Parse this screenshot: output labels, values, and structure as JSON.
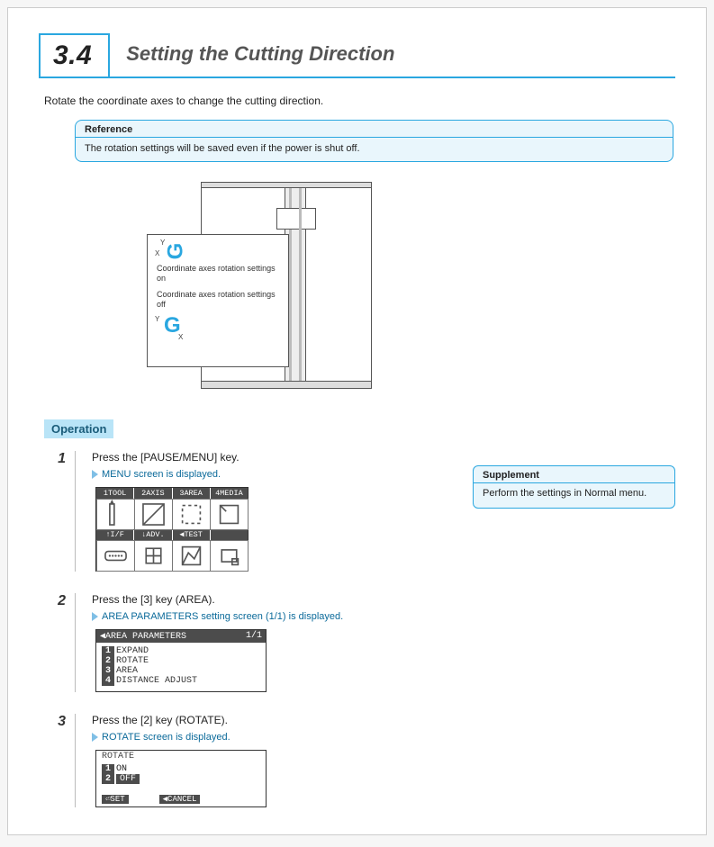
{
  "section": {
    "number": "3.4",
    "title": "Setting the Cutting Direction"
  },
  "intro": "Rotate the coordinate axes to change the cutting direction.",
  "reference": {
    "label": "Reference",
    "body": "The rotation settings will be saved even if the power is shut off."
  },
  "diagram": {
    "caption_on": "Coordinate axes rotation settings on",
    "caption_off": "Coordinate axes rotation settings off",
    "axis_y": "Y",
    "axis_x": "X"
  },
  "operation_label": "Operation",
  "supplement": {
    "label": "Supplement",
    "body": "Perform the settings in Normal menu."
  },
  "steps": [
    {
      "n": "1",
      "title": "Press the [PAUSE/MENU] key.",
      "sub": "MENU screen is displayed.",
      "menu_tabs_row1": [
        "1TOOL",
        "2AXIS",
        "3AREA",
        "4MEDIA"
      ],
      "menu_tabs_row2": [
        "↑I/F",
        "↓ADV.",
        "◀TEST",
        ""
      ]
    },
    {
      "n": "2",
      "title": "Press the [3] key (AREA).",
      "sub": "AREA PARAMETERS setting screen (1/1) is displayed.",
      "lcd_header_left": "◀AREA PARAMETERS",
      "lcd_header_right": "1/1",
      "items": [
        "EXPAND",
        "ROTATE",
        "AREA",
        "DISTANCE ADJUST"
      ]
    },
    {
      "n": "3",
      "title": "Press the [2] key (ROTATE).",
      "sub": "ROTATE screen is displayed.",
      "lcd_header": "ROTATE",
      "items": [
        {
          "k": "1",
          "v": "ON",
          "sel": false
        },
        {
          "k": "2",
          "v": "OFF",
          "sel": true
        }
      ],
      "foot_left": "⏎SET",
      "foot_right": "◀CANCEL"
    }
  ]
}
